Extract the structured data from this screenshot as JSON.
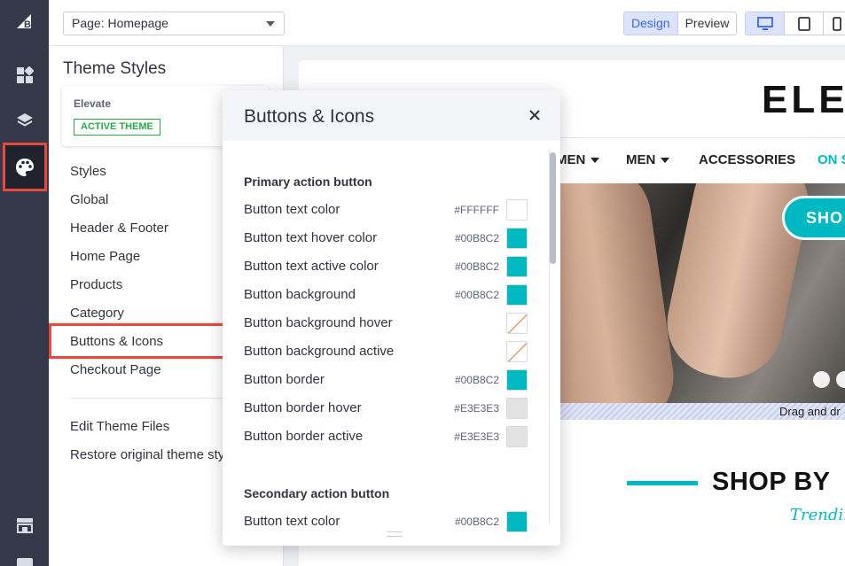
{
  "toolbar": {
    "page_select_value": "Page: Homepage",
    "mode_tabs": [
      "Design",
      "Preview"
    ],
    "device_buttons": [
      "desktop-icon",
      "tablet-icon",
      "mobile-icon"
    ]
  },
  "rail": {
    "icons": [
      "bigcommerce-logo-icon",
      "widgets-icon",
      "layers-icon",
      "palette-icon",
      "storefront-icon"
    ],
    "active_icon": "palette-icon"
  },
  "sidebar": {
    "title": "Theme Styles",
    "theme_name": "Elevate",
    "theme_badge": "ACTIVE THEME",
    "items": [
      {
        "label": "Styles"
      },
      {
        "label": "Global"
      },
      {
        "label": "Header & Footer"
      },
      {
        "label": "Home Page"
      },
      {
        "label": "Products"
      },
      {
        "label": "Category"
      },
      {
        "label": "Buttons & Icons"
      },
      {
        "label": "Checkout Page"
      }
    ],
    "footer_items": [
      {
        "label": "Edit Theme Files"
      },
      {
        "label": "Restore original theme sty"
      }
    ]
  },
  "panel": {
    "title": "Buttons & Icons",
    "sections": [
      {
        "heading": "Primary action button",
        "rows": [
          {
            "label": "Button text color",
            "hex": "#FFFFFF",
            "color": "#FFFFFF"
          },
          {
            "label": "Button text hover color",
            "hex": "#00B8C2",
            "color": "#00B8C2"
          },
          {
            "label": "Button text active color",
            "hex": "#00B8C2",
            "color": "#00B8C2"
          },
          {
            "label": "Button background",
            "hex": "#00B8C2",
            "color": "#00B8C2"
          },
          {
            "label": "Button background hover",
            "hex": "",
            "color": "transparent"
          },
          {
            "label": "Button background active",
            "hex": "",
            "color": "transparent"
          },
          {
            "label": "Button border",
            "hex": "#00B8C2",
            "color": "#00B8C2"
          },
          {
            "label": "Button border hover",
            "hex": "#E3E3E3",
            "color": "#E3E3E3"
          },
          {
            "label": "Button border active",
            "hex": "#E3E3E3",
            "color": "#E3E3E3"
          }
        ]
      },
      {
        "heading": "Secondary action button",
        "rows": [
          {
            "label": "Button text color",
            "hex": "#00B8C2",
            "color": "#00B8C2"
          }
        ]
      }
    ]
  },
  "preview": {
    "logo": "ELEV",
    "nav": [
      "MEN",
      "MEN",
      "ACCESSORIES",
      "ON S"
    ],
    "hero_button": "SHO",
    "drag_text": "Drag and dr",
    "shop_by": "SHOP BY",
    "trending": "Trendin"
  },
  "colors": {
    "accent": "#00B8C2",
    "highlight": "#E8493F",
    "rail": "#34394A",
    "active_blue": "#3C64F4"
  }
}
